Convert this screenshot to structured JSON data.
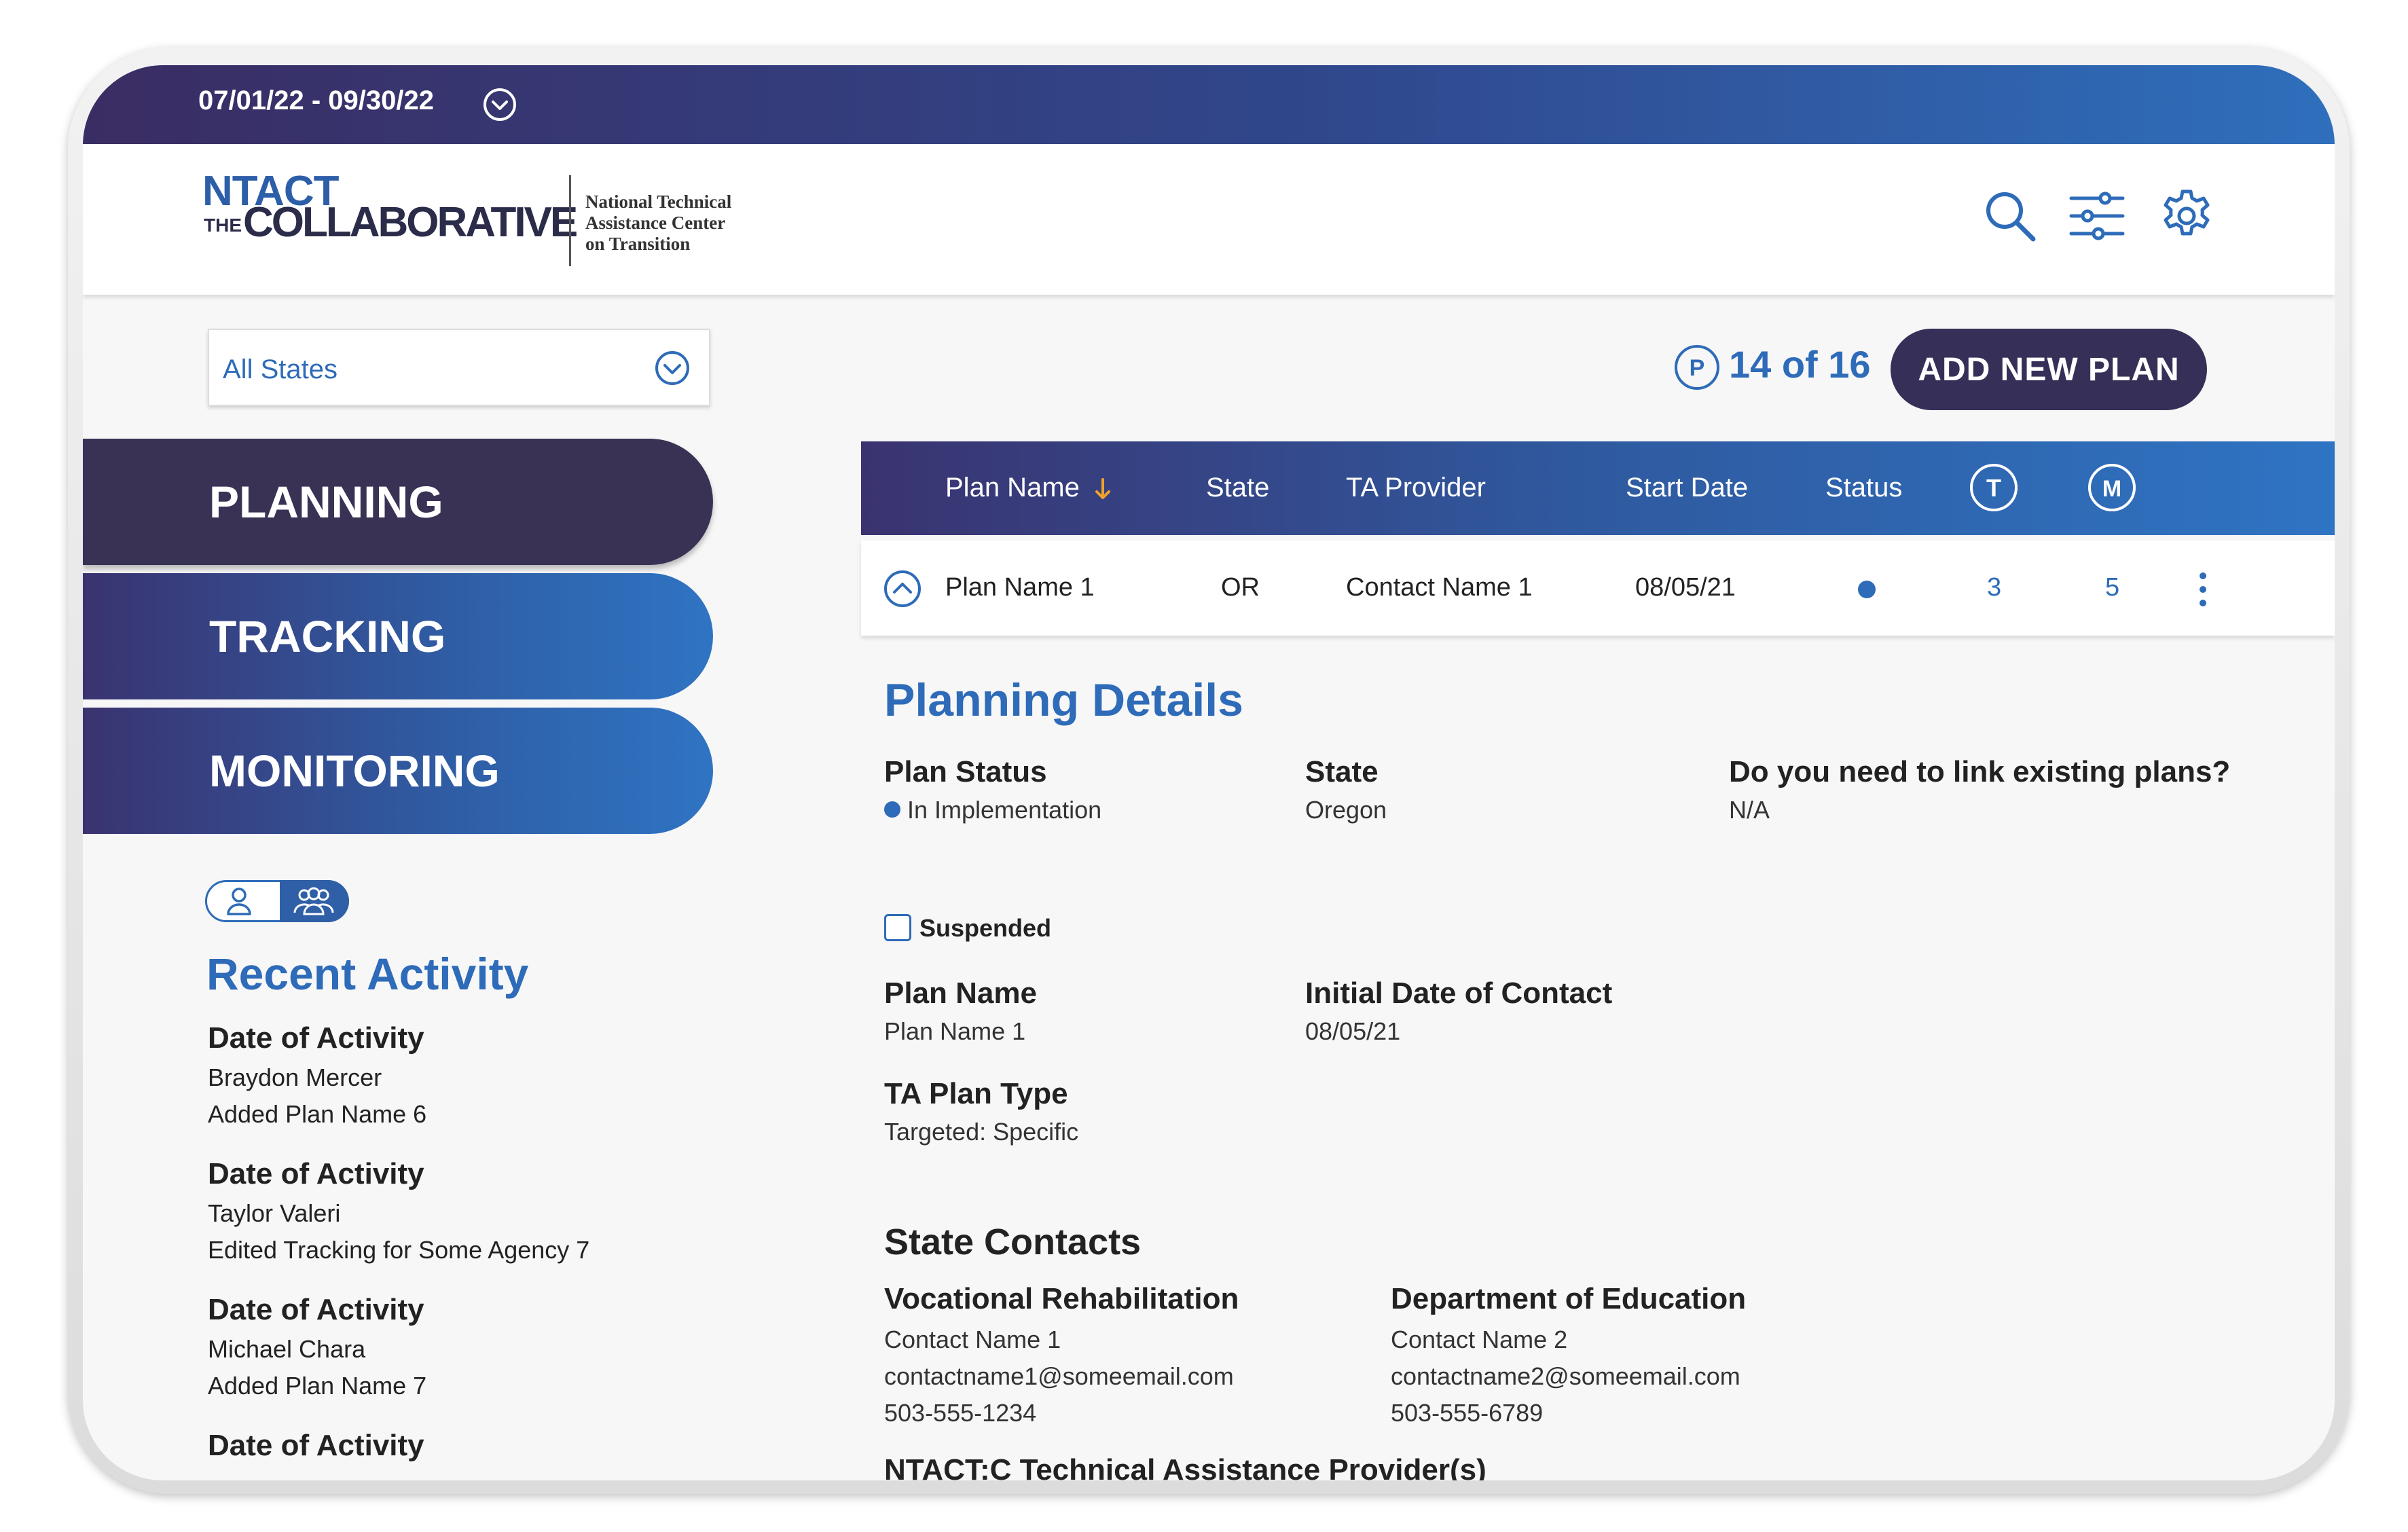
{
  "datebar": {
    "range": "07/01/22 - 09/30/22"
  },
  "logo": {
    "ntact": "NTACT",
    "the": "THE",
    "collaborative": "COLLABORATIVE",
    "sub_line1": "National Technical",
    "sub_line2": "Assistance Center",
    "sub_line3": "on Transition"
  },
  "header_icons": [
    "search-icon",
    "filter-sliders-icon",
    "gear-icon"
  ],
  "states_filter": {
    "selected": "All States"
  },
  "nav": {
    "planning": "PLANNING",
    "tracking": "TRACKING",
    "monitoring": "MONITORING"
  },
  "recent_activity": {
    "title": "Recent Activity",
    "items": [
      {
        "heading": "Date of Activity",
        "user": "Braydon Mercer",
        "action": "Added Plan Name 6"
      },
      {
        "heading": "Date of Activity",
        "user": "Taylor Valeri",
        "action": "Edited Tracking for Some Agency 7"
      },
      {
        "heading": "Date of Activity",
        "user": "Michael Chara",
        "action": "Added Plan Name 7"
      },
      {
        "heading": "Date of Activity"
      }
    ]
  },
  "plan_counter": {
    "badge": "P",
    "count": "14 of 16"
  },
  "add_plan_button": "ADD NEW PLAN",
  "table": {
    "columns": {
      "plan_name": "Plan Name",
      "state": "State",
      "ta_provider": "TA Provider",
      "start_date": "Start Date",
      "status": "Status",
      "t": "T",
      "m": "M"
    },
    "row": {
      "plan_name": "Plan Name 1",
      "state": "OR",
      "ta_provider": "Contact Name 1",
      "start_date": "08/05/21",
      "t": "3",
      "m": "5"
    }
  },
  "planning_details": {
    "title": "Planning Details",
    "plan_status_label": "Plan Status",
    "plan_status_value": "In Implementation",
    "suspended_label": "Suspended",
    "state_label": "State",
    "state_value": "Oregon",
    "link_label": "Do you need to link existing plans?",
    "link_value": "N/A",
    "plan_name_label": "Plan Name",
    "plan_name_value": "Plan Name 1",
    "initial_contact_label": "Initial Date of Contact",
    "initial_contact_value": "08/05/21",
    "ta_plan_type_label": "TA Plan Type",
    "ta_plan_type_value": "Targeted: Specific"
  },
  "state_contacts": {
    "title": "State Contacts",
    "vr": {
      "label": "Vocational Rehabilitation",
      "name": "Contact Name 1",
      "email": "contactname1@someemail.com",
      "phone": "503-555-1234"
    },
    "doe": {
      "label": "Department of Education",
      "name": "Contact Name 2",
      "email": "contactname2@someemail.com",
      "phone": "503-555-6789"
    },
    "providers_title": "NTACT:C Technical Assistance Provider(s)"
  },
  "colors": {
    "accent_blue": "#2e6bb8",
    "dark_navy": "#363058",
    "status_dot": "#2e6bb8"
  }
}
